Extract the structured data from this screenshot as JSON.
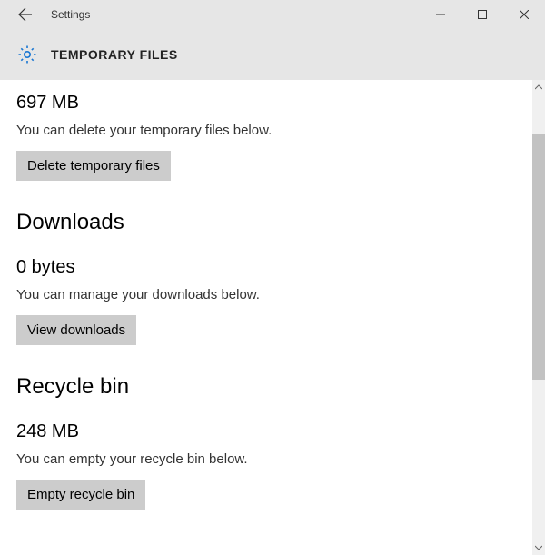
{
  "window": {
    "title": "Settings"
  },
  "header": {
    "title": "TEMPORARY FILES"
  },
  "sections": {
    "temp": {
      "size": "697 MB",
      "description": "You can delete your temporary files below.",
      "button_label": "Delete temporary files"
    },
    "downloads": {
      "title": "Downloads",
      "size": "0 bytes",
      "description": "You can manage your downloads below.",
      "button_label": "View downloads"
    },
    "recycle": {
      "title": "Recycle bin",
      "size": "248 MB",
      "description": "You can empty your recycle bin below.",
      "button_label": "Empty recycle bin"
    }
  }
}
